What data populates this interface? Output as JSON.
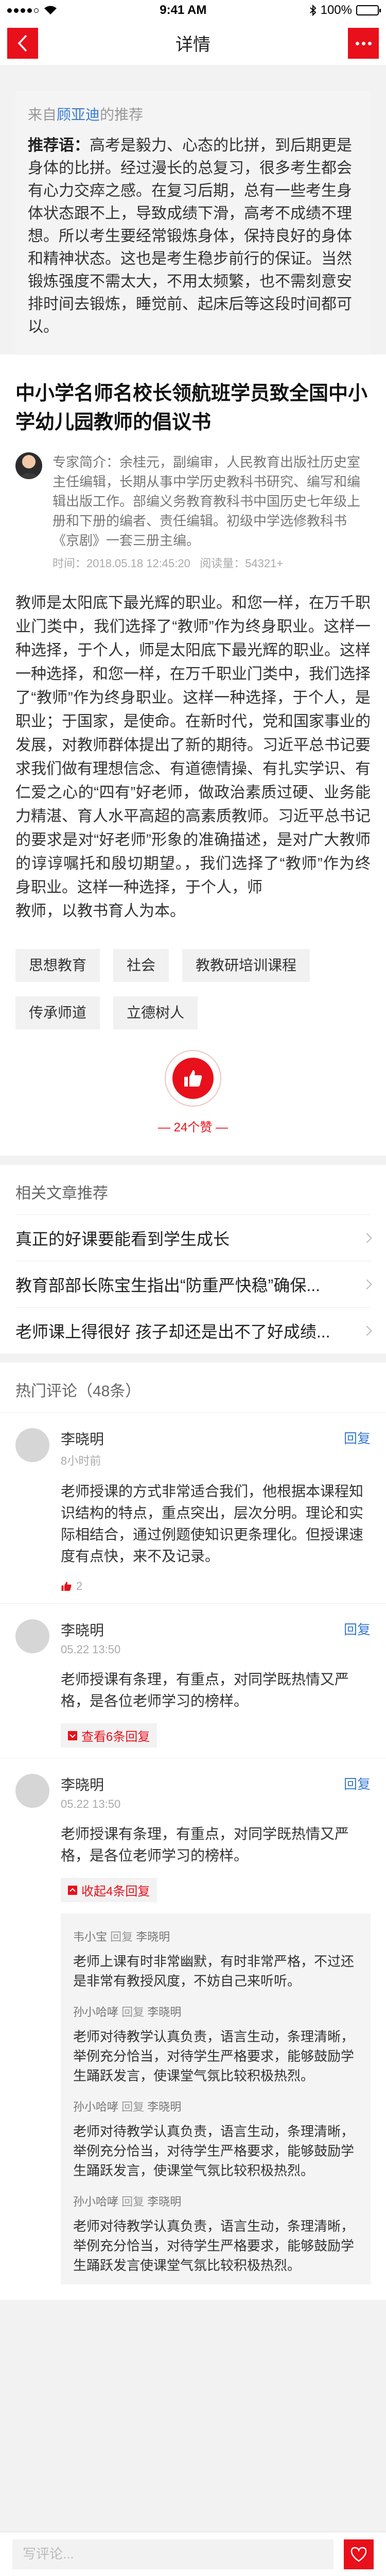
{
  "status_bar": {
    "time": "9:41 AM",
    "battery": "100%"
  },
  "nav": {
    "title": "详情"
  },
  "recommend": {
    "prefix": "来自",
    "user": "顾亚迪",
    "suffix": "的推荐",
    "label": "推荐语：",
    "text": "高考是毅力、心态的比拼，到后期更是身体的比拼。经过漫长的总复习，很多考生都会有心力交瘁之感。在复习后期，总有一些考生身体状态跟不上，导致成绩下滑，高考不成绩不理想。所以考生要经常锻炼身体，保持良好的身体和精神状态。这也是考生稳步前行的保证。当然锻炼强度不需太大，不用太频繁，也不需刻意安排时间去锻炼，睡觉前、起床后等这段时间都可以。"
  },
  "article": {
    "title": "中小学名师名校长领航班学员致全国中小学幼儿园教师的倡议书",
    "author_intro": "专家简介：余桂元，副编审，人民教育出版社历史室主任编辑，长期从事中学历史教科书研究、编写和编辑出版工作。部编义务教育教科书中国历史七年级上册和下册的编者、责任编辑。初级中学选修教科书《京剧》一套三册主编。",
    "time": "时间：2018.05.18 12:45:20",
    "reads": "阅读量：54321+",
    "body": "教师是太阳底下最光辉的职业。和您一样，在万千职业门类中，我们选择了“教师”作为终身职业。这样一种选择，于个人，师是太阳底下最光辉的职业。这样一种选择，和您一样，在万千职业门类中，我们选择了“教师”作为终身职业。这样一种选择，于个人，是职业；于国家，是使命。在新时代，党和国家事业的发展，对教师群体提出了新的期待。习近平总书记要求我们做有理想信念、有道德情操、有扎实学识、有仁爱之心的“四有”好老师，做政治素质过硬、业务能力精湛、育人水平高超的高素质教师。习近平总书记的要求是对“好老师”形象的准确描述，是对广大教师的谆谆嘱托和殷切期望。，我们选择了“教师”作为终身职业。这样一种选择，于个人，师\n教师，以教书育人为本。",
    "tags": [
      "思想教育",
      "社会",
      "教教研培训课程",
      "传承师道",
      "立德树人"
    ],
    "likes": "24个赞"
  },
  "related": {
    "title": "相关文章推荐",
    "items": [
      "真正的好课要能看到学生成长",
      "教育部部长陈宝生指出“防重严快稳”确保...",
      "老师课上得很好 孩子却还是出不了好成绩..."
    ]
  },
  "comments": {
    "title": "热门评论（48条）",
    "reply_label": "回复",
    "items": [
      {
        "name": "李晓明",
        "time": "8小时前",
        "text": "老师授课的方式非常适合我们，他根据本课程知识结构的特点，重点突出，层次分明。理论和实际相结合，通过例题使知识更条理化。但授课速度有点快，来不及记录。",
        "likes": "2"
      },
      {
        "name": "李晓明",
        "time": "05.22 13:50",
        "text": "老师授课有条理，有重点，对同学既热情又严格，是各位老师学习的榜样。",
        "toggle": "查看6条回复"
      },
      {
        "name": "李晓明",
        "time": "05.22 13:50",
        "text": "老师授课有条理，有重点，对同学既热情又严格，是各位老师学习的榜样。",
        "toggle": "收起4条回复",
        "replies": [
          {
            "from": "韦小宝",
            "verb": "回复",
            "to": "李晓明",
            "text": "老师上课有时非常幽默，有时非常严格，不过还是非常有教授风度，不妨自己来听听。"
          },
          {
            "from": "孙小哈哮",
            "verb": "回复",
            "to": "李晓明",
            "text": "老师对待教学认真负责，语言生动，条理清晰，举例充分恰当，对待学生严格要求，能够鼓励学生踊跃发言，使课堂气氛比较积极热烈。"
          },
          {
            "from": "孙小哈哮",
            "verb": "回复",
            "to": "李晓明",
            "text": "老师对待教学认真负责，语言生动，条理清晰，举例充分恰当，对待学生严格要求，能够鼓励学生踊跃发言，使课堂气氛比较积极热烈。"
          },
          {
            "from": "孙小哈哮",
            "verb": "回复",
            "to": "李晓明",
            "text": "老师对待教学认真负责，语言生动，条理清晰，举例充分恰当，对待学生严格要求，能够鼓励学生踊跃发言使课堂气氛比较积极热烈。"
          }
        ]
      }
    ]
  },
  "footer": {
    "placeholder": "写评论..."
  },
  "colors": {
    "accent": "#e8101a",
    "link": "#3a7bd5"
  }
}
